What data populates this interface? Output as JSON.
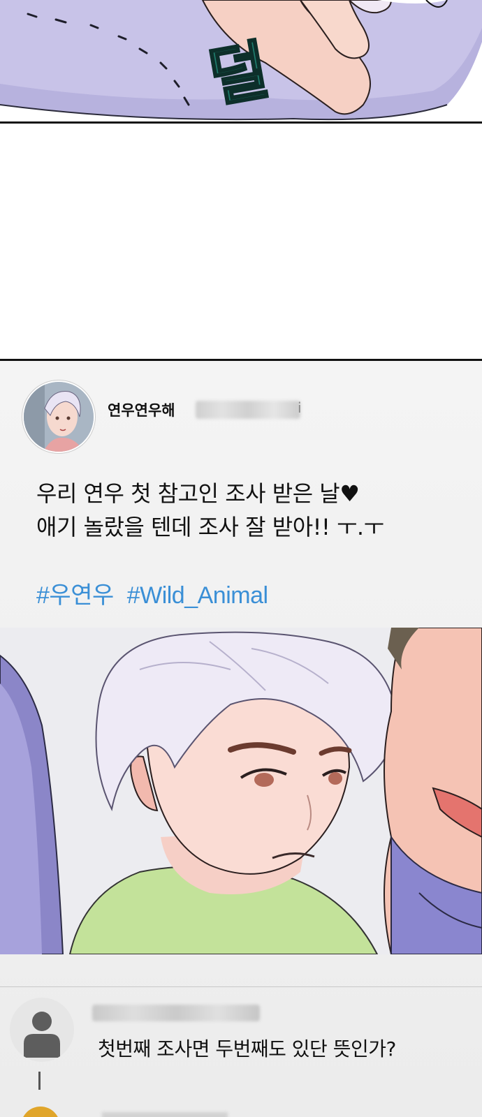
{
  "top_panel": {
    "sfx": "덜"
  },
  "post": {
    "username": "연우연우해",
    "handle_tail": "i",
    "lines": [
      "우리 연우 첫 참고인 조사 받은 날♥",
      "애기 놀랐을 텐데 조사 잘 받아!! ㅜ.ㅜ"
    ],
    "hashtags": [
      "#우연우",
      "#Wild_Animal"
    ]
  },
  "comment": {
    "text": "첫번째 조사면 두번째도 있단 뜻인가?"
  },
  "colors": {
    "hashtag": "#3a8fd6",
    "sfx_fill": "#1f7d6e",
    "sleeve": "#a8a4d6"
  }
}
